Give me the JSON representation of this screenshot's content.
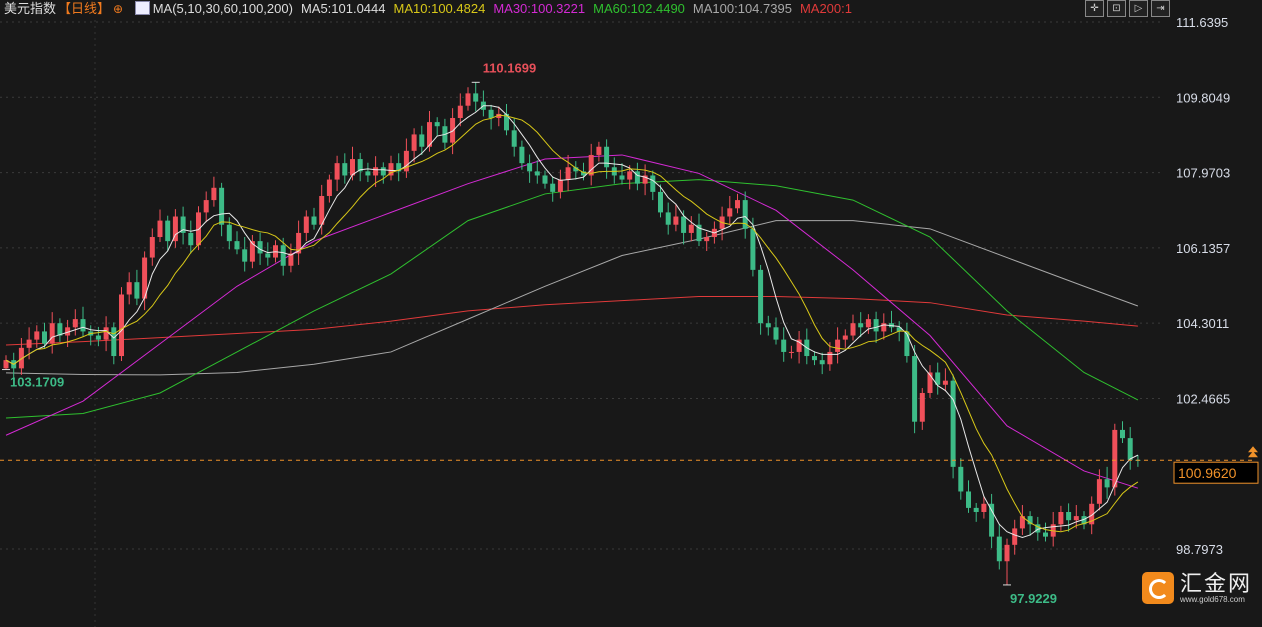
{
  "header": {
    "title": "美元指数",
    "period": "【日线】",
    "period_icon": "circle-plus-icon",
    "ma_icon": "chart-icon",
    "ma_set": "MA(5,10,30,60,100,200)",
    "ma_labels": [
      {
        "text": "MA5:101.0444",
        "color": "#dddddd"
      },
      {
        "text": "MA10:100.4824",
        "color": "#d8c818"
      },
      {
        "text": "MA30:100.3221",
        "color": "#d42ad4"
      },
      {
        "text": "MA60:102.4490",
        "color": "#2fc02f"
      },
      {
        "text": "MA100:104.7395",
        "color": "#a8a8a8"
      },
      {
        "text": "MA200:1",
        "color": "#e03a3a"
      }
    ]
  },
  "toolbar": {
    "icons": [
      "crosshair-icon",
      "zoom-fit-icon",
      "play-forward-icon",
      "exit-right-icon"
    ],
    "glyphs": [
      "✛",
      "⊡",
      "▷",
      "⇥"
    ]
  },
  "logo": {
    "name": "汇金网",
    "url": "www.gold678.com"
  },
  "colors": {
    "background": "#181818",
    "up": "#f0505a",
    "down": "#3dbb87",
    "ma5": "#e8e8e8",
    "ma10": "#d8c818",
    "ma30": "#d42ad4",
    "ma60": "#2fc02f",
    "ma100": "#a8a8a8",
    "ma200": "#e03a3a",
    "last_price": "#f0922a"
  },
  "chart_data": {
    "type": "candlestick",
    "title": "美元指数",
    "y_ticks": [
      "111.6395",
      "109.8049",
      "107.9703",
      "106.1357",
      "104.3011",
      "102.4665",
      "98.7973"
    ],
    "ylim": [
      97.45,
      111.9
    ],
    "grid": true,
    "last_price": "100.9620",
    "annotations": {
      "high": {
        "text": "110.1699",
        "value": 110.1699,
        "bar": 61
      },
      "low": {
        "text": "97.9229",
        "value": 97.9229,
        "bar": 130
      },
      "left": {
        "text": "103.1709",
        "value": 103.1709,
        "bar": 0
      }
    },
    "close": [
      103.4,
      103.2,
      103.7,
      103.9,
      104.1,
      103.8,
      104.3,
      104.0,
      104.2,
      104.4,
      104.1,
      104.0,
      103.9,
      104.2,
      103.5,
      105.0,
      105.3,
      104.9,
      105.9,
      106.4,
      106.8,
      106.3,
      106.9,
      106.5,
      106.2,
      107.0,
      107.3,
      107.6,
      106.7,
      106.3,
      106.1,
      105.8,
      106.3,
      106.0,
      105.9,
      106.2,
      105.7,
      106.0,
      106.5,
      106.9,
      106.7,
      107.4,
      107.8,
      108.2,
      107.9,
      108.3,
      108.0,
      107.9,
      108.1,
      107.9,
      108.2,
      108.0,
      108.5,
      108.9,
      108.6,
      109.2,
      109.1,
      108.7,
      109.3,
      109.6,
      109.9,
      109.7,
      109.5,
      109.3,
      109.4,
      109.0,
      108.6,
      108.2,
      108.0,
      107.9,
      107.7,
      107.5,
      107.8,
      108.1,
      108.0,
      107.9,
      108.4,
      108.6,
      108.1,
      107.9,
      107.8,
      108.0,
      107.7,
      107.9,
      107.5,
      107.0,
      106.7,
      106.9,
      106.5,
      106.7,
      106.3,
      106.4,
      106.6,
      106.9,
      107.1,
      107.3,
      106.6,
      105.6,
      104.3,
      104.2,
      103.9,
      103.6,
      103.6,
      103.9,
      103.5,
      103.4,
      103.3,
      103.6,
      103.9,
      104.0,
      104.3,
      104.2,
      104.4,
      104.1,
      104.3,
      104.2,
      104.1,
      103.5,
      101.9,
      102.6,
      103.1,
      102.8,
      102.9,
      100.8,
      100.2,
      99.8,
      99.7,
      99.9,
      99.1,
      98.5,
      98.9,
      99.3,
      99.6,
      99.4,
      99.2,
      99.1,
      99.4,
      99.7,
      99.5,
      99.6,
      99.4,
      99.9,
      100.5,
      100.3,
      101.7,
      101.5,
      100.97,
      100.96
    ],
    "moving_averages": [
      {
        "name": "MA200",
        "color": "#e03a3a",
        "values": [
          103.77,
          103.85,
          103.95,
          104.05,
          104.15,
          104.35,
          104.6,
          104.75,
          104.85,
          104.95,
          104.95,
          104.9,
          104.8,
          104.5,
          104.35,
          104.23
        ]
      },
      {
        "name": "MA100",
        "color": "#a8a8a8",
        "values": [
          103.09,
          103.05,
          103.04,
          103.1,
          103.3,
          103.6,
          104.4,
          105.2,
          105.95,
          106.35,
          106.8,
          106.8,
          106.6,
          105.9,
          105.2,
          104.72
        ]
      },
      {
        "name": "MA60",
        "color": "#2fc02f",
        "values": [
          101.99,
          102.1,
          102.6,
          103.6,
          104.6,
          105.5,
          106.8,
          107.45,
          107.7,
          107.8,
          107.65,
          107.3,
          106.4,
          104.6,
          103.1,
          102.43
        ]
      },
      {
        "name": "MA30",
        "color": "#d42ad4",
        "values": [
          101.57,
          102.4,
          103.8,
          105.2,
          106.3,
          107.0,
          107.7,
          108.3,
          108.4,
          107.95,
          107.05,
          105.6,
          104.0,
          101.8,
          100.7,
          100.28
        ]
      }
    ]
  }
}
